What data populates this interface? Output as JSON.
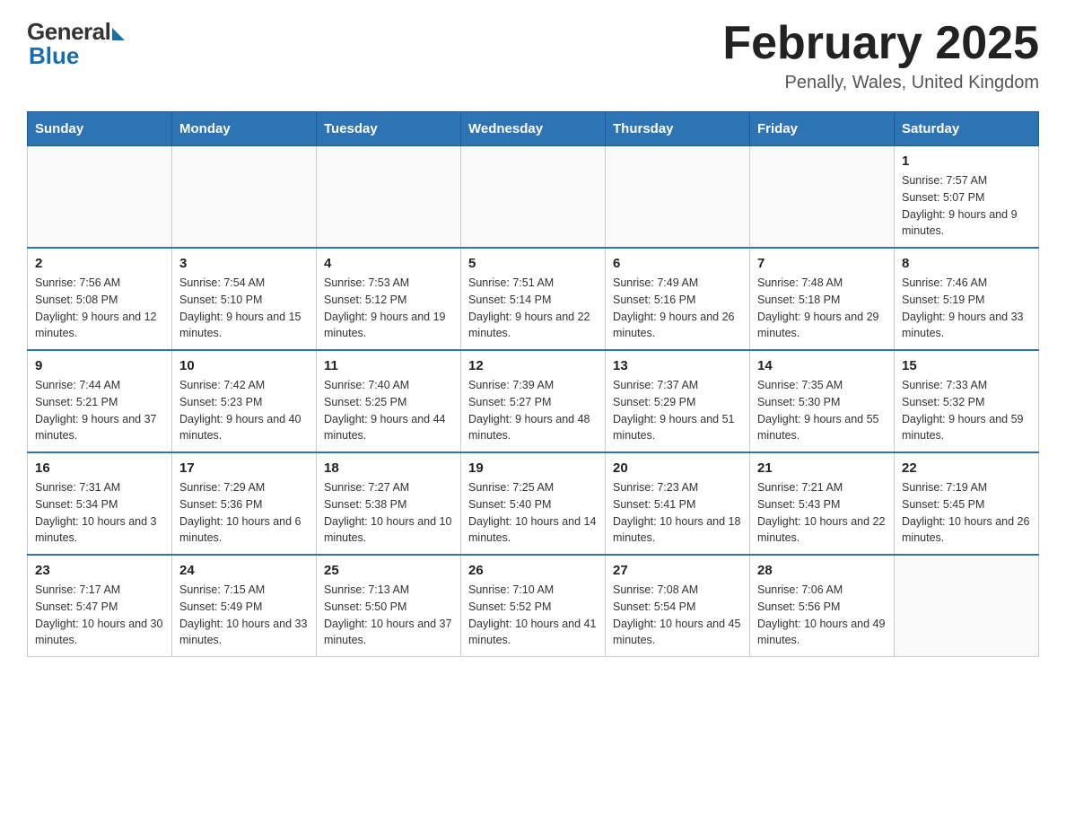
{
  "logo": {
    "general": "General",
    "blue": "Blue"
  },
  "title": "February 2025",
  "location": "Penally, Wales, United Kingdom",
  "days_of_week": [
    "Sunday",
    "Monday",
    "Tuesday",
    "Wednesday",
    "Thursday",
    "Friday",
    "Saturday"
  ],
  "weeks": [
    [
      {
        "day": "",
        "info": ""
      },
      {
        "day": "",
        "info": ""
      },
      {
        "day": "",
        "info": ""
      },
      {
        "day": "",
        "info": ""
      },
      {
        "day": "",
        "info": ""
      },
      {
        "day": "",
        "info": ""
      },
      {
        "day": "1",
        "info": "Sunrise: 7:57 AM\nSunset: 5:07 PM\nDaylight: 9 hours and 9 minutes."
      }
    ],
    [
      {
        "day": "2",
        "info": "Sunrise: 7:56 AM\nSunset: 5:08 PM\nDaylight: 9 hours and 12 minutes."
      },
      {
        "day": "3",
        "info": "Sunrise: 7:54 AM\nSunset: 5:10 PM\nDaylight: 9 hours and 15 minutes."
      },
      {
        "day": "4",
        "info": "Sunrise: 7:53 AM\nSunset: 5:12 PM\nDaylight: 9 hours and 19 minutes."
      },
      {
        "day": "5",
        "info": "Sunrise: 7:51 AM\nSunset: 5:14 PM\nDaylight: 9 hours and 22 minutes."
      },
      {
        "day": "6",
        "info": "Sunrise: 7:49 AM\nSunset: 5:16 PM\nDaylight: 9 hours and 26 minutes."
      },
      {
        "day": "7",
        "info": "Sunrise: 7:48 AM\nSunset: 5:18 PM\nDaylight: 9 hours and 29 minutes."
      },
      {
        "day": "8",
        "info": "Sunrise: 7:46 AM\nSunset: 5:19 PM\nDaylight: 9 hours and 33 minutes."
      }
    ],
    [
      {
        "day": "9",
        "info": "Sunrise: 7:44 AM\nSunset: 5:21 PM\nDaylight: 9 hours and 37 minutes."
      },
      {
        "day": "10",
        "info": "Sunrise: 7:42 AM\nSunset: 5:23 PM\nDaylight: 9 hours and 40 minutes."
      },
      {
        "day": "11",
        "info": "Sunrise: 7:40 AM\nSunset: 5:25 PM\nDaylight: 9 hours and 44 minutes."
      },
      {
        "day": "12",
        "info": "Sunrise: 7:39 AM\nSunset: 5:27 PM\nDaylight: 9 hours and 48 minutes."
      },
      {
        "day": "13",
        "info": "Sunrise: 7:37 AM\nSunset: 5:29 PM\nDaylight: 9 hours and 51 minutes."
      },
      {
        "day": "14",
        "info": "Sunrise: 7:35 AM\nSunset: 5:30 PM\nDaylight: 9 hours and 55 minutes."
      },
      {
        "day": "15",
        "info": "Sunrise: 7:33 AM\nSunset: 5:32 PM\nDaylight: 9 hours and 59 minutes."
      }
    ],
    [
      {
        "day": "16",
        "info": "Sunrise: 7:31 AM\nSunset: 5:34 PM\nDaylight: 10 hours and 3 minutes."
      },
      {
        "day": "17",
        "info": "Sunrise: 7:29 AM\nSunset: 5:36 PM\nDaylight: 10 hours and 6 minutes."
      },
      {
        "day": "18",
        "info": "Sunrise: 7:27 AM\nSunset: 5:38 PM\nDaylight: 10 hours and 10 minutes."
      },
      {
        "day": "19",
        "info": "Sunrise: 7:25 AM\nSunset: 5:40 PM\nDaylight: 10 hours and 14 minutes."
      },
      {
        "day": "20",
        "info": "Sunrise: 7:23 AM\nSunset: 5:41 PM\nDaylight: 10 hours and 18 minutes."
      },
      {
        "day": "21",
        "info": "Sunrise: 7:21 AM\nSunset: 5:43 PM\nDaylight: 10 hours and 22 minutes."
      },
      {
        "day": "22",
        "info": "Sunrise: 7:19 AM\nSunset: 5:45 PM\nDaylight: 10 hours and 26 minutes."
      }
    ],
    [
      {
        "day": "23",
        "info": "Sunrise: 7:17 AM\nSunset: 5:47 PM\nDaylight: 10 hours and 30 minutes."
      },
      {
        "day": "24",
        "info": "Sunrise: 7:15 AM\nSunset: 5:49 PM\nDaylight: 10 hours and 33 minutes."
      },
      {
        "day": "25",
        "info": "Sunrise: 7:13 AM\nSunset: 5:50 PM\nDaylight: 10 hours and 37 minutes."
      },
      {
        "day": "26",
        "info": "Sunrise: 7:10 AM\nSunset: 5:52 PM\nDaylight: 10 hours and 41 minutes."
      },
      {
        "day": "27",
        "info": "Sunrise: 7:08 AM\nSunset: 5:54 PM\nDaylight: 10 hours and 45 minutes."
      },
      {
        "day": "28",
        "info": "Sunrise: 7:06 AM\nSunset: 5:56 PM\nDaylight: 10 hours and 49 minutes."
      },
      {
        "day": "",
        "info": ""
      }
    ]
  ]
}
